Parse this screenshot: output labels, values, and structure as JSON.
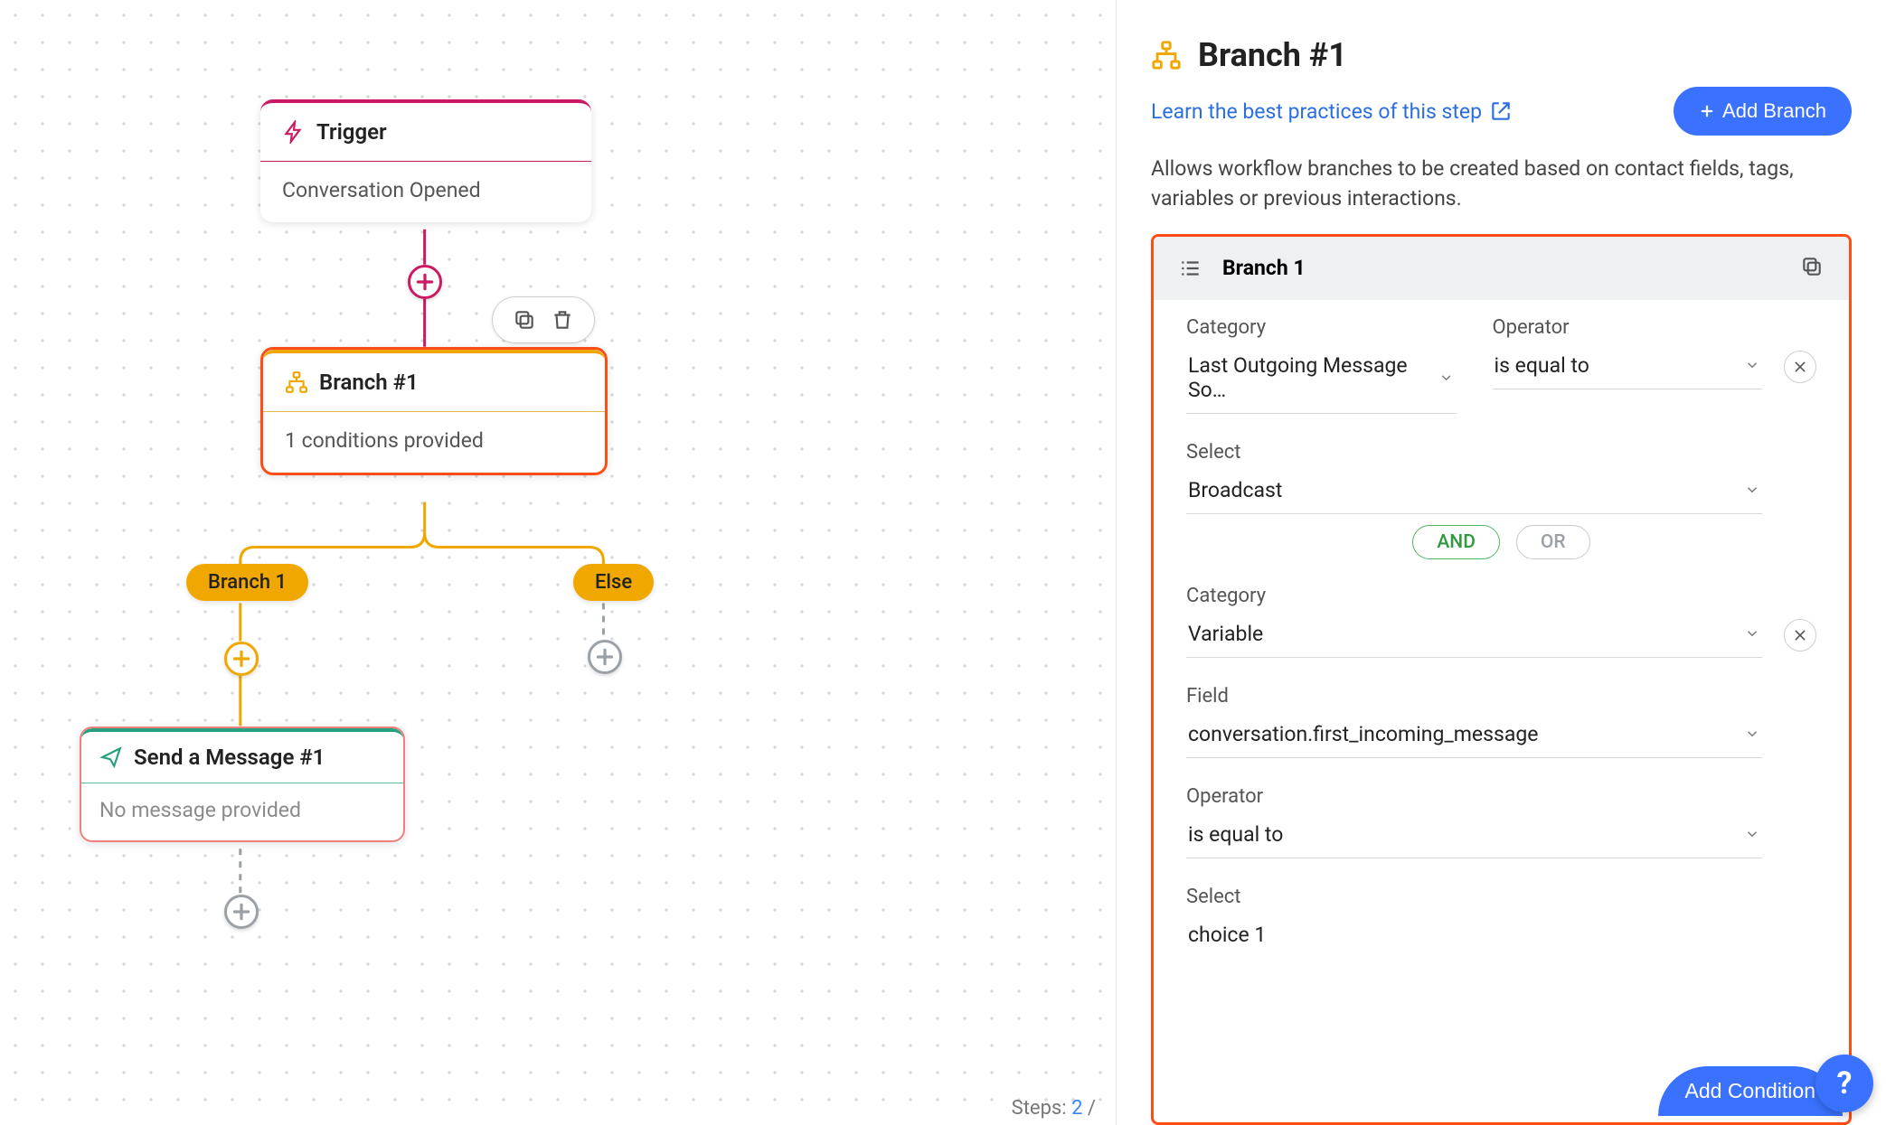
{
  "canvas": {
    "trigger": {
      "title": "Trigger",
      "body": "Conversation Opened"
    },
    "branch": {
      "title": "Branch #1",
      "body": "1 conditions provided"
    },
    "send": {
      "title": "Send a Message #1",
      "body": "No message provided"
    },
    "pills": {
      "branch1": "Branch 1",
      "else": "Else"
    },
    "steps": {
      "label": "Steps: ",
      "count": "2",
      "suffix": " /"
    }
  },
  "sidebar": {
    "title": "Branch #1",
    "learn": "Learn the best practices of this step",
    "add_branch": "Add Branch",
    "description": "Allows workflow branches to be created based on contact fields, tags, variables or previous interactions.",
    "panel_title": "Branch 1",
    "logic": {
      "and": "AND",
      "or": "OR"
    },
    "add_condition": "Add Condition",
    "cond1": {
      "category_label": "Category",
      "category_value": "Last Outgoing Message So…",
      "operator_label": "Operator",
      "operator_value": "is equal to",
      "select_label": "Select",
      "select_value": "Broadcast"
    },
    "cond2": {
      "category_label": "Category",
      "category_value": "Variable",
      "field_label": "Field",
      "field_value": "conversation.first_incoming_message",
      "operator_label": "Operator",
      "operator_value": "is equal to",
      "select_label": "Select",
      "select_value": "choice 1"
    }
  }
}
